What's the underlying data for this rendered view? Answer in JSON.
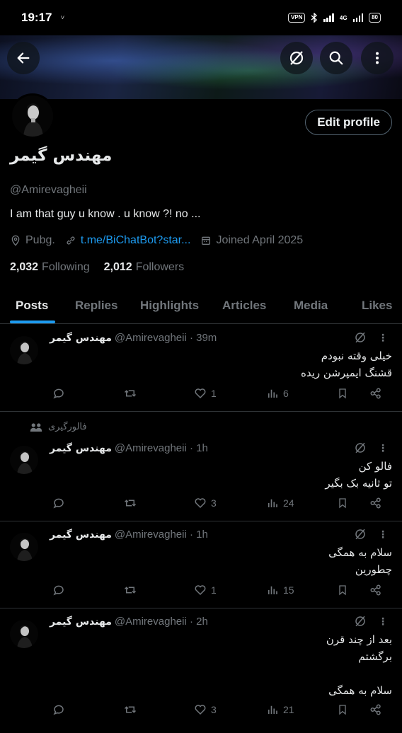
{
  "status_bar": {
    "time": "19:17",
    "chevron": "˅",
    "vpn": "VPN",
    "network": "4G",
    "battery": "80"
  },
  "header": {
    "back_icon": "arrow-left-icon",
    "grok_icon": "grok-icon",
    "search_icon": "search-icon",
    "more_icon": "more-vertical-icon"
  },
  "profile": {
    "name": "مهندس گیمر",
    "handle": "@Amirevagheii",
    "bio": "I am that guy u know . u know ?! no ...",
    "location": "Pubg.",
    "link": "t.me/BiChatBot?star...",
    "joined": "Joined April 2025",
    "following_count": "2,032",
    "following_label": "Following",
    "followers_count": "2,012",
    "followers_label": "Followers",
    "edit_label": "Edit profile"
  },
  "tabs": [
    {
      "label": "Posts",
      "active": true
    },
    {
      "label": "Replies"
    },
    {
      "label": "Highlights"
    },
    {
      "label": "Articles"
    },
    {
      "label": "Media"
    },
    {
      "label": "Likes"
    }
  ],
  "posts": [
    {
      "name": "مهندس گیمر",
      "sub": "@Amirevagheii · 39m",
      "text": "خیلی وقته نبودم\nقشنگ ایمپرشن ریده",
      "likes": "1",
      "views": "6",
      "context": ""
    },
    {
      "name": "مهندس گیمر",
      "sub": "@Amirevagheii · 1h",
      "text": "فالو کن\nتو ثانیه بک بگیر",
      "likes": "3",
      "views": "24",
      "context": "فالورگیری"
    },
    {
      "name": "مهندس گیمر",
      "sub": "@Amirevagheii · 1h",
      "text": "سلام به همگی\nچطورین",
      "likes": "1",
      "views": "15",
      "context": ""
    },
    {
      "name": "مهندس گیمر",
      "sub": "@Amirevagheii · 2h",
      "text": "بعد از چند قرن\nبرگشتم\n\nسلام به همگی",
      "likes": "3",
      "views": "21",
      "context": ""
    }
  ],
  "colors": {
    "accent": "#1d9bf0",
    "muted": "#71767b",
    "text": "#e7e9ea",
    "divider": "#2f3336",
    "background": "#000000"
  }
}
